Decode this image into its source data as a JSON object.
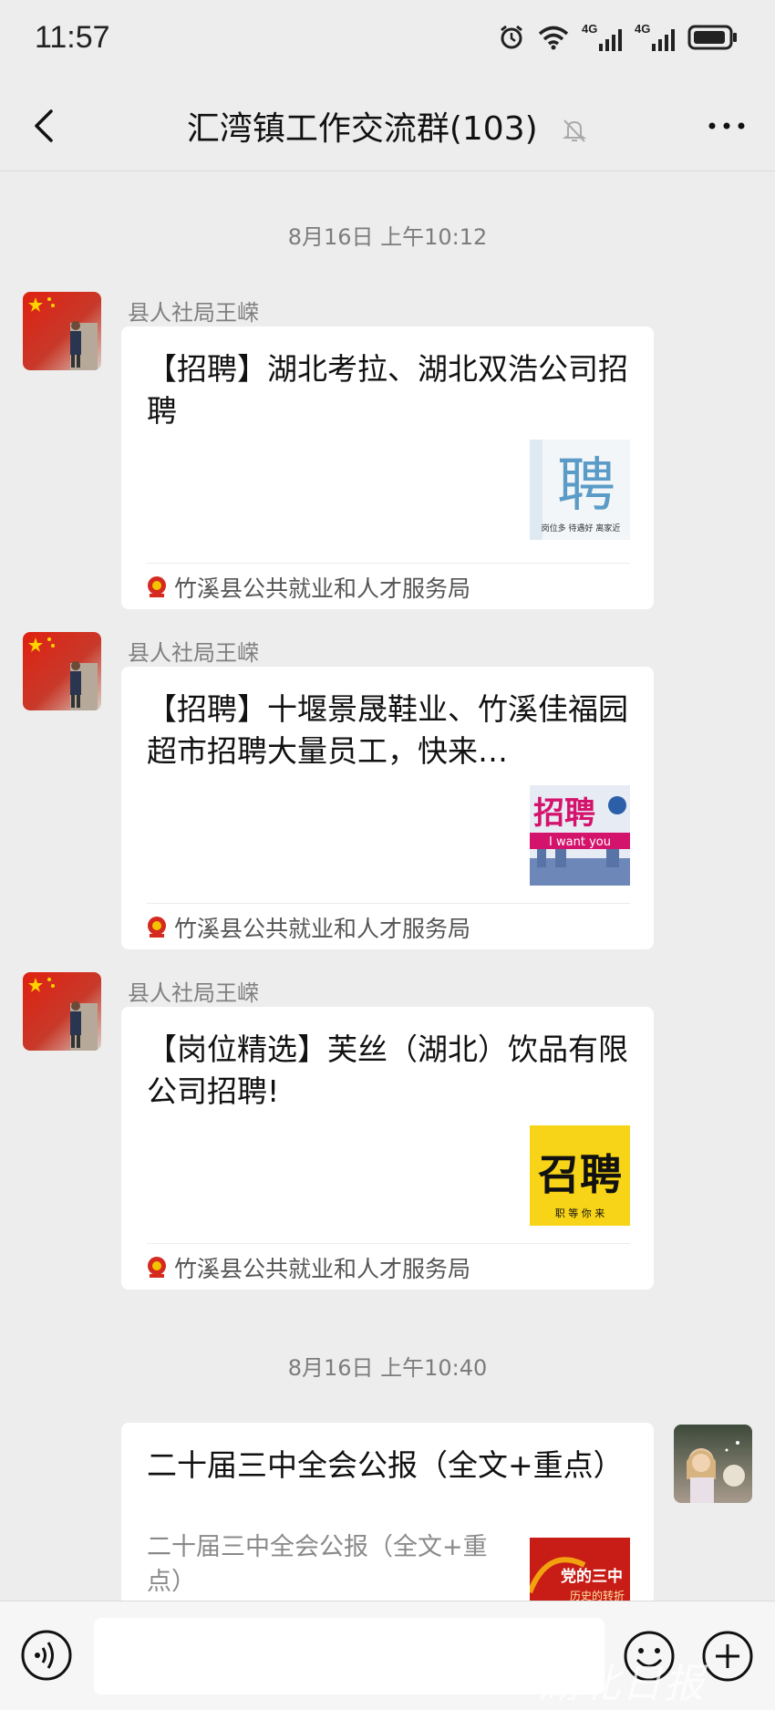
{
  "status_bar": {
    "time": "11:57",
    "network_1": "4G",
    "network_2": "4G",
    "icons": [
      "alarm-icon",
      "wifi-icon",
      "signal-icon",
      "signal-icon",
      "battery-icon"
    ]
  },
  "nav": {
    "title": "汇湾镇工作交流群(103)",
    "back_icon": "chevron-left-icon",
    "mute_icon": "bell-off-icon",
    "more_icon": "more-icon"
  },
  "timestamps": [
    "8月16日 上午10:12",
    "8月16日 上午10:40"
  ],
  "messages": [
    {
      "sender": "县人社局王嵘",
      "title": "【招聘】湖北考拉、湖北双浩公司招聘",
      "source": "竹溪县公共就业和人才服务局",
      "thumb_text": "聘",
      "thumb_caption": "岗位多 待遇好 离家近"
    },
    {
      "sender": "县人社局王嵘",
      "title": "【招聘】十堰景晟鞋业、竹溪佳福园超市招聘大量员工，快来…",
      "source": "竹溪县公共就业和人才服务局",
      "thumb_text": "招聘",
      "thumb_caption": "I want you"
    },
    {
      "sender": "县人社局王嵘",
      "title": "【岗位精选】芙丝（湖北）饮品有限公司招聘!",
      "source": "竹溪县公共就业和人才服务局",
      "thumb_text": "召聘",
      "thumb_caption": "职 等 你 来"
    }
  ],
  "own_message": {
    "title": "二十届三中全会公报（全文+重点）",
    "description": "二十届三中全会公报（全文+重点）",
    "thumb_text": "党的三中",
    "thumb_caption": "历史的转折"
  },
  "input_bar": {
    "voice_icon": "voice-icon",
    "emoji_icon": "emoji-icon",
    "add_icon": "plus-icon"
  },
  "watermark": "湖北日报",
  "colors": {
    "background": "#ededed",
    "card": "#ffffff",
    "meta_text": "#7c7c7c",
    "accent_red": "#d42a20"
  }
}
